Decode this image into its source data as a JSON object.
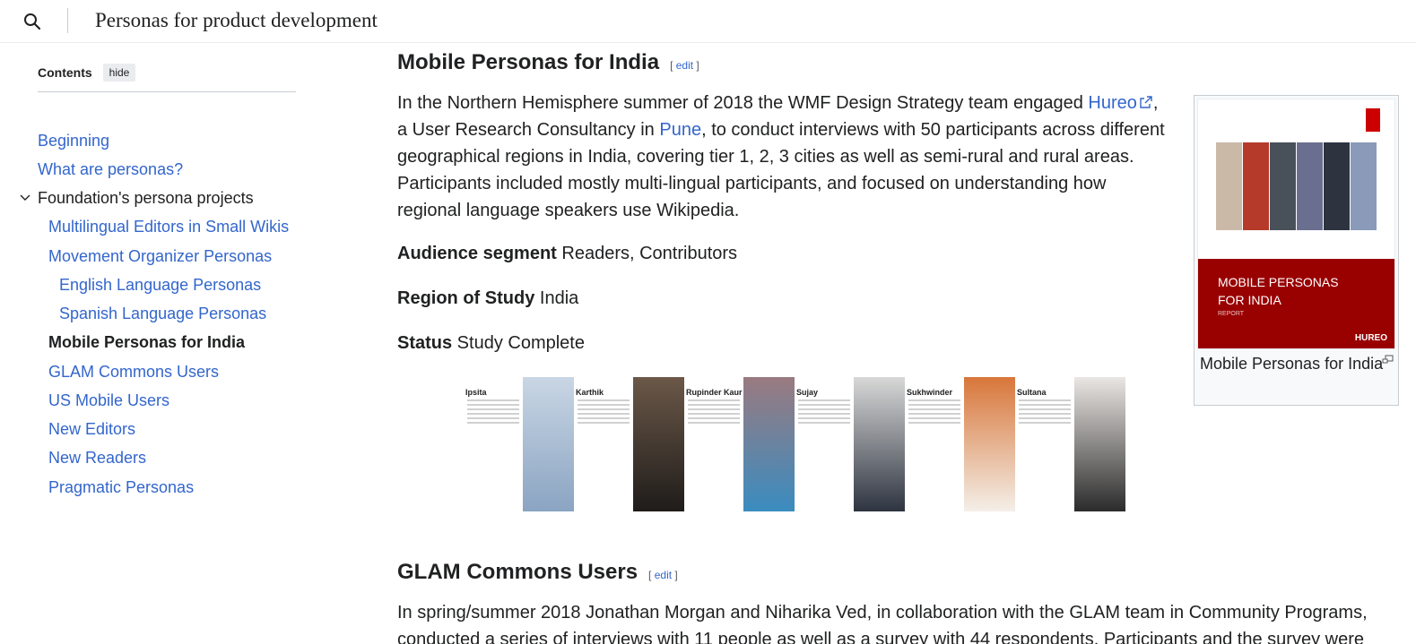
{
  "header": {
    "search_icon": "search-icon",
    "title": "Personas for product development"
  },
  "toc": {
    "title": "Contents",
    "hide_label": "hide",
    "items": [
      {
        "label": "Beginning",
        "level": 1,
        "state": "link"
      },
      {
        "label": "What are personas?",
        "level": 1,
        "state": "link"
      },
      {
        "label": "Foundation's persona projects",
        "level": 1,
        "state": "expanded"
      },
      {
        "label": "Multilingual Editors in Small Wikis",
        "level": 2,
        "state": "link"
      },
      {
        "label": "Movement Organizer Personas",
        "level": 2,
        "state": "link"
      },
      {
        "label": "English Language Personas",
        "level": 3,
        "state": "link"
      },
      {
        "label": "Spanish Language Personas",
        "level": 3,
        "state": "link"
      },
      {
        "label": "Mobile Personas for India",
        "level": 2,
        "state": "current"
      },
      {
        "label": "GLAM Commons Users",
        "level": 2,
        "state": "link"
      },
      {
        "label": "US Mobile Users",
        "level": 2,
        "state": "link"
      },
      {
        "label": "New Editors",
        "level": 2,
        "state": "link"
      },
      {
        "label": "New Readers",
        "level": 2,
        "state": "link"
      },
      {
        "label": "Pragmatic Personas",
        "level": 2,
        "state": "link"
      }
    ]
  },
  "section1": {
    "heading": "Mobile Personas for India",
    "edit_open": "[ ",
    "edit_label": "edit",
    "edit_close": " ]",
    "para": {
      "t1": "In the Northern Hemisphere summer of 2018 the WMF Design Strategy team engaged ",
      "link1": "Hureo",
      "t2": ",",
      "t3": "a User Research Consultancy in ",
      "link2": "Pune",
      "t4": ", to conduct interviews with 50 participants across different",
      "l3": "geographical regions in India, covering tier 1, 2, 3 cities as well as semi-rural and rural areas.",
      "l4": "Participants included mostly multi-lingual participants, and focused on understanding how",
      "l5": "regional language speakers use Wikipedia."
    },
    "audience_label": "Audience segment",
    "audience_value": " Readers, Contributors",
    "region_label": "Region of Study",
    "region_value": " India",
    "status_label": "Status",
    "status_value": " Study Complete"
  },
  "thumb": {
    "cover_title_1": "MOBILE PERSONAS",
    "cover_title_2": "FOR INDIA",
    "cover_report": "REPORT",
    "cover_logo": "HUREO",
    "caption": "Mobile Personas for India"
  },
  "personas": [
    {
      "name": "Ipsita",
      "photo": "#b7c6d8"
    },
    {
      "name": "Karthik",
      "photo": "#3a3530"
    },
    {
      "name": "Rupinder Kaur",
      "photo": "#9a7a80"
    },
    {
      "name": "Sujay",
      "photo": "#2e3440"
    },
    {
      "name": "Sukhwinder",
      "photo": "#c9a27a"
    },
    {
      "name": "Sultana",
      "photo": "#d8d0cc"
    }
  ],
  "section2": {
    "heading": "GLAM Commons Users",
    "edit_open": "[ ",
    "edit_label": "edit",
    "edit_close": " ]",
    "para_l1": "In spring/summer 2018 Jonathan Morgan and Niharika Ved, in collaboration with the GLAM team in Community Programs,",
    "para_l2": "conducted a series of interviews with 11 people as well as a survey with 44 respondents. Participants and the survey were"
  }
}
